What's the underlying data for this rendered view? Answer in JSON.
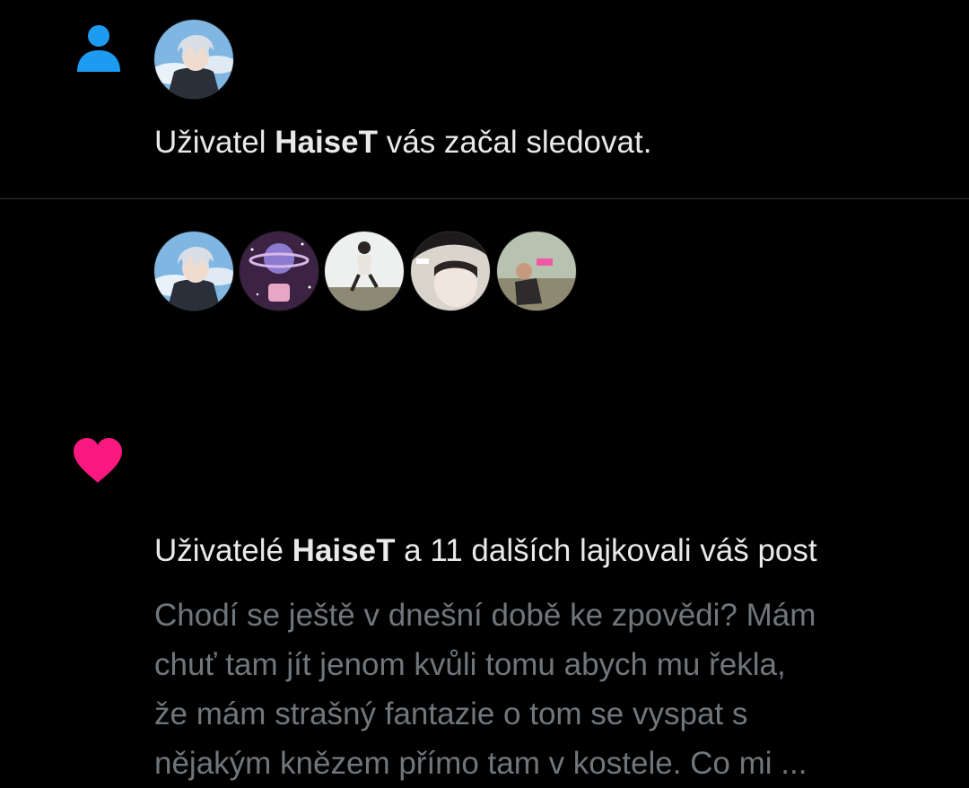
{
  "follow_notification": {
    "icon": "person-icon",
    "icon_color": "#1d9bf0",
    "text_before": "Uživatel ",
    "username": "HaiseT",
    "text_after": " vás začal sledovat."
  },
  "like_notification": {
    "icon": "heart-icon",
    "icon_color": "#f91880",
    "text_before": "Uživatelé ",
    "username": "HaiseT",
    "text_after": " a 11 dalších lajkovali váš post",
    "post_preview_lines": [
      "Chodí se ještě v dnešní době ke zpovědi? Mám",
      "chuť tam jít jenom kvůli tomu abych mu řekla,",
      "že mám strašný fantazie o tom se vyspat s",
      "nějakým knězem přímo tam v kostele. Co mi ..."
    ]
  },
  "colors": {
    "background": "#000000",
    "primary_text": "#e7e9ea",
    "secondary_text": "#71767b",
    "divider": "#2f3336"
  }
}
